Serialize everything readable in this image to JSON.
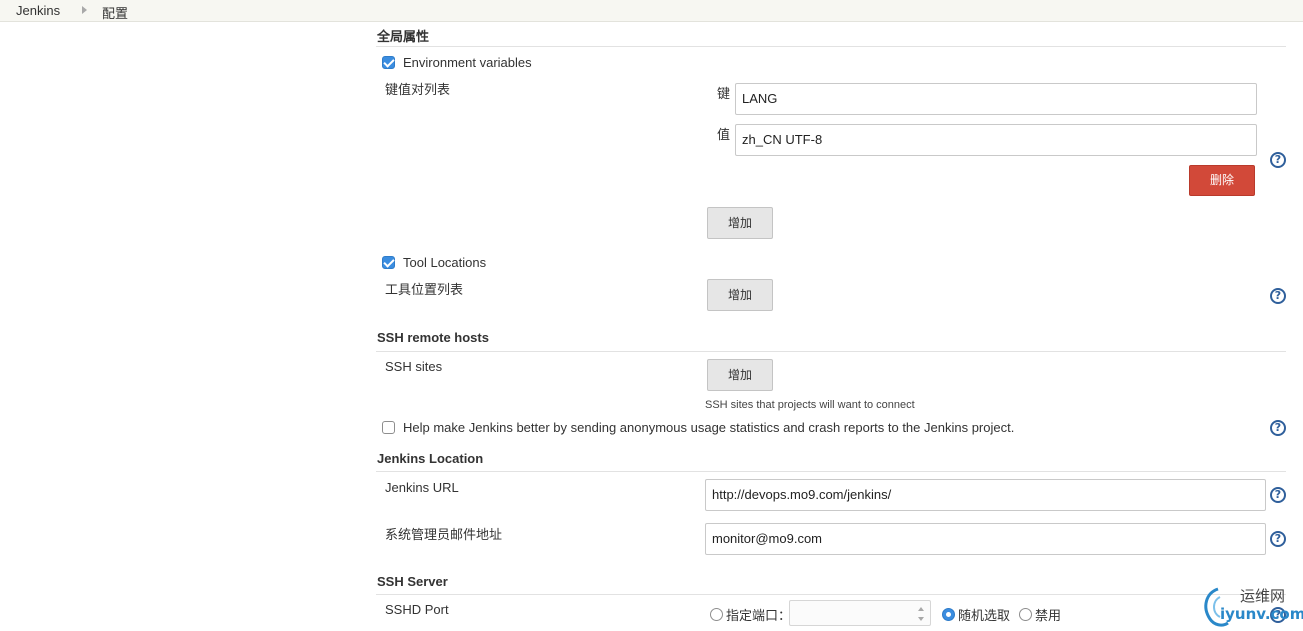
{
  "breadcrumb": {
    "root": "Jenkins",
    "current": "配置"
  },
  "global_properties": {
    "title": "全局属性",
    "env_vars": {
      "label": "Environment variables",
      "checked": true,
      "list_label": "键值对列表",
      "key_label": "键",
      "key_value": "LANG",
      "value_label": "值",
      "value_value": "zh_CN UTF-8",
      "delete_label": "删除",
      "add_label": "增加"
    },
    "tool_locations": {
      "label": "Tool Locations",
      "checked": true,
      "list_label": "工具位置列表",
      "add_label": "增加"
    }
  },
  "ssh_remote_hosts": {
    "title": "SSH remote hosts",
    "sites_label": "SSH sites",
    "add_label": "增加",
    "hint": "SSH sites that projects will want to connect"
  },
  "usage_stats": {
    "label": "Help make Jenkins better by sending anonymous usage statistics and crash reports to the Jenkins project.",
    "checked": false
  },
  "jenkins_location": {
    "title": "Jenkins Location",
    "url_label": "Jenkins URL",
    "url_value": "http://devops.mo9.com/jenkins/",
    "email_label": "系统管理员邮件地址",
    "email_value": "monitor@mo9.com"
  },
  "ssh_server": {
    "title": "SSH Server",
    "port_label": "SSHD Port",
    "option_fixed": "指定端口：",
    "option_random": "随机选取",
    "option_disabled": "禁用",
    "selected": "随机选取"
  },
  "watermark": {
    "line1": "运维网",
    "line2": "iyunv.com"
  },
  "icons": {
    "help": "help-icon",
    "check": "checkbox-icon",
    "separator": "breadcrumb-arrow-icon"
  },
  "colors": {
    "delete": "#d24939",
    "accent": "#3b8de0",
    "help": "#2f5f9b"
  }
}
